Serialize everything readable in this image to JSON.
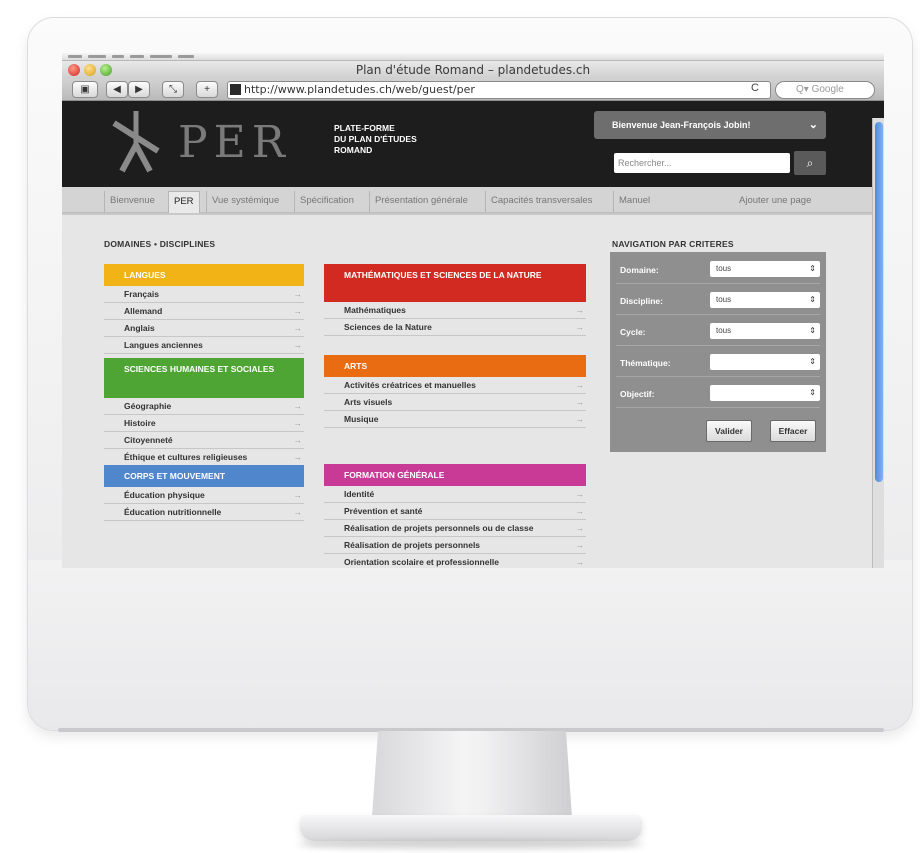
{
  "window": {
    "title": "Plan d'étude Romand – plandetudes.ch",
    "url": "http://www.plandetudes.ch/web/guest/per",
    "search_placeholder": "Q▾ Google",
    "reload_glyph": "C"
  },
  "header": {
    "logo_text": "PER",
    "platform_lines": [
      "PLATE-FORME",
      "DU PLAN D'ÉTUDES",
      "ROMAND"
    ],
    "welcome": "Bienvenue Jean-François Jobin!",
    "search_placeholder": "Rechercher..."
  },
  "tabs": [
    {
      "label": "Bienvenue"
    },
    {
      "label": "PER",
      "active": true
    },
    {
      "label": "Vue systémique"
    },
    {
      "label": "Spécification"
    },
    {
      "label": "Présentation générale"
    },
    {
      "label": "Capacités transversales"
    },
    {
      "label": "Manuel"
    },
    {
      "label": "Ajouter une page"
    }
  ],
  "domains": {
    "title": "DOMAINES • DISCIPLINES",
    "left": [
      {
        "head": "LANGUES",
        "color": "#f2b316",
        "items": [
          "Français",
          "Allemand",
          "Anglais",
          "Langues anciennes"
        ]
      },
      {
        "head": "SCIENCES HUMAINES ET SOCIALES",
        "color": "#4ea534",
        "items": [
          "Géographie",
          "Histoire",
          "Citoyenneté",
          "Éthique et cultures religieuses"
        ]
      },
      {
        "head": "CORPS ET MOUVEMENT",
        "color": "#4f86cc",
        "items": [
          "Éducation physique",
          "Éducation nutritionnelle"
        ]
      }
    ],
    "right": [
      {
        "head": "MATHÉMATIQUES ET SCIENCES DE LA NATURE",
        "color": "#d22a20",
        "items": [
          "Mathématiques",
          "Sciences de la Nature"
        ]
      },
      {
        "head": "ARTS",
        "color": "#ea6c12",
        "items": [
          "Activités créatrices et manuelles",
          "Arts visuels",
          "Musique"
        ]
      },
      {
        "head": "FORMATION GÉNÉRALE",
        "color": "#c83a96",
        "items": [
          "Identité",
          "Prévention et santé",
          "Réalisation de projets personnels ou de classe",
          "Réalisation de projets personnels",
          "Orientation scolaire et professionnelle"
        ]
      }
    ]
  },
  "criteria": {
    "title": "NAVIGATION PAR CRITERES",
    "rows": [
      {
        "label": "Domaine:",
        "value": "tous"
      },
      {
        "label": "Discipline:",
        "value": "tous"
      },
      {
        "label": "Cycle:",
        "value": "tous"
      },
      {
        "label": "Thématique:",
        "value": ""
      },
      {
        "label": "Objectif:",
        "value": ""
      }
    ],
    "validate": "Valider",
    "clear": "Effacer"
  },
  "arrow_glyph": "→",
  "updown_glyph": "⇕",
  "chevron_glyph": "⌄",
  "search_glyph": "⌕"
}
